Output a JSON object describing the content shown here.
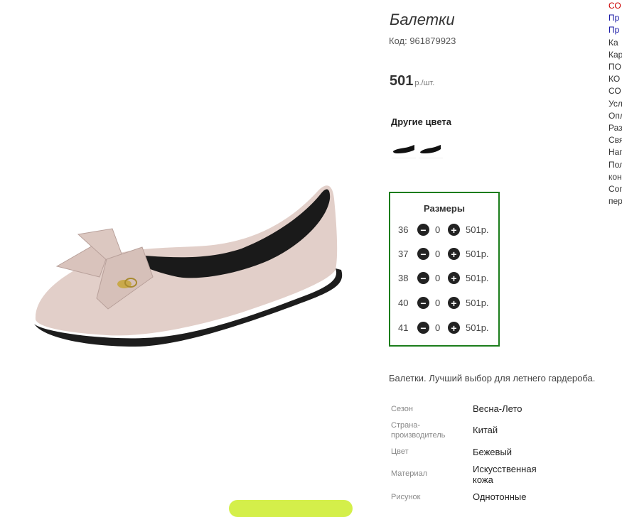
{
  "product": {
    "title": "Балетки",
    "code": "Код: 961879923",
    "price_value": "501",
    "price_unit": "р./шт.",
    "other_colors_heading": "Другие цвета",
    "sizes_heading": "Размеры",
    "sizes": [
      {
        "size": "36",
        "qty": "0",
        "price": "501р."
      },
      {
        "size": "37",
        "qty": "0",
        "price": "501р."
      },
      {
        "size": "38",
        "qty": "0",
        "price": "501р."
      },
      {
        "size": "40",
        "qty": "0",
        "price": "501р."
      },
      {
        "size": "41",
        "qty": "0",
        "price": "501р."
      }
    ],
    "description": "Балетки. Лучший выбор для летнего гардероба.",
    "specs": [
      {
        "key": "Сезон",
        "value": "Весна-Лето"
      },
      {
        "key": "Страна-\nпроизводитель",
        "value": "Китай"
      },
      {
        "key": "Цвет",
        "value": "Бежевый"
      },
      {
        "key": "Материал",
        "value": "Искусственная кожа"
      },
      {
        "key": "Рисунок",
        "value": "Однотонные"
      }
    ]
  },
  "right_nav": [
    {
      "label": "СО",
      "color": "#cc0000"
    },
    {
      "label": "Пр",
      "color": "#1a1aa6"
    },
    {
      "label": "Пр",
      "color": "#1a1aa6"
    },
    {
      "label": "Ка",
      "color": "#333333"
    },
    {
      "label": "Кар",
      "color": "#333333"
    },
    {
      "label": "ПО",
      "color": "#333333"
    },
    {
      "label": "КО",
      "color": "#333333"
    },
    {
      "label": "СО",
      "color": "#333333"
    },
    {
      "label": "Усл",
      "color": "#333333"
    },
    {
      "label": "Опл",
      "color": "#333333"
    },
    {
      "label": "Раз",
      "color": "#333333"
    },
    {
      "label": "Свя",
      "color": "#333333"
    },
    {
      "label": "Нап",
      "color": "#333333"
    },
    {
      "label": "Пол",
      "color": "#333333"
    },
    {
      "label": "кон",
      "color": "#333333"
    },
    {
      "label": "Сог",
      "color": "#333333"
    },
    {
      "label": "пер",
      "color": "#333333"
    }
  ],
  "colors": {
    "sizes_border": "#1b7d1b",
    "cta_button": "#d4ef4a"
  },
  "icons": {
    "minus": "minus-circle-icon",
    "plus": "plus-circle-icon"
  }
}
